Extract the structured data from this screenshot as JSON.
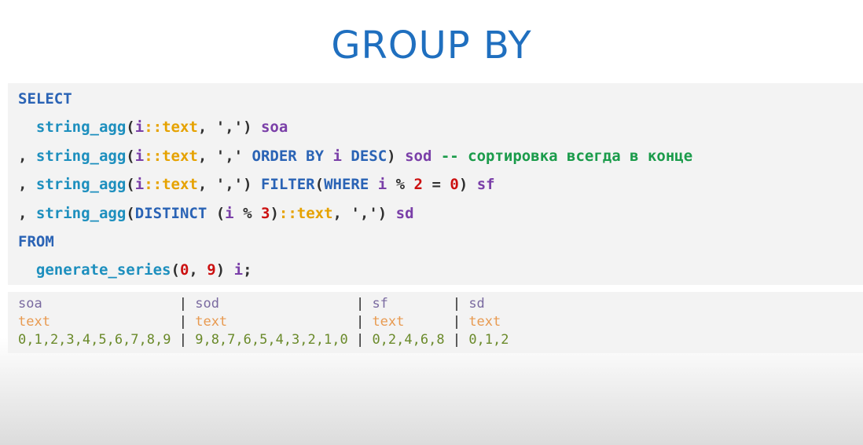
{
  "slide": {
    "title": "GROUP BY"
  },
  "code": {
    "select_kw": "SELECT",
    "l2_fn": "string_agg",
    "l2_open": "(",
    "l2_var": "i",
    "l2_cast": "::text",
    "l2_comma": ",",
    "l2_str": "','",
    "l2_close": ")",
    "l2_alias": "soa",
    "l3_lead": ",",
    "l3_fn": "string_agg",
    "l3_open": "(",
    "l3_var": "i",
    "l3_cast": "::text",
    "l3_comma": ",",
    "l3_str": "','",
    "l3_kw": "ORDER BY",
    "l3_var2": "i",
    "l3_kw2": "DESC",
    "l3_close": ")",
    "l3_alias": "sod",
    "l3_comment": "-- сортировка всегда в конце",
    "l4_lead": ",",
    "l4_fn": "string_agg",
    "l4_open": "(",
    "l4_var": "i",
    "l4_cast": "::text",
    "l4_comma": ",",
    "l4_str": "','",
    "l4_close": ")",
    "l4_kw": "FILTER",
    "l4_open2": "(",
    "l4_kw2": "WHERE",
    "l4_var2": "i",
    "l4_op": "%",
    "l4_num": "2",
    "l4_eq": "=",
    "l4_num2": "0",
    "l4_close2": ")",
    "l4_alias": "sf",
    "l5_lead": ",",
    "l5_fn": "string_agg",
    "l5_open": "(",
    "l5_kw": "DISTINCT",
    "l5_open2": "(",
    "l5_var": "i",
    "l5_op": "%",
    "l5_num": "3",
    "l5_close2": ")",
    "l5_cast": "::text",
    "l5_comma": ",",
    "l5_str": "','",
    "l5_close": ")",
    "l5_alias": "sd",
    "from_kw": "FROM",
    "l7_fn": "generate_series",
    "l7_open": "(",
    "l7_num": "0",
    "l7_comma": ",",
    "l7_num2": "9",
    "l7_close": ")",
    "l7_var": "i",
    "l7_semi": ";"
  },
  "result": {
    "headers": [
      "soa",
      "sod",
      "sf",
      "sd"
    ],
    "types": [
      "text",
      "text",
      "text",
      "text"
    ],
    "values": [
      "0,1,2,3,4,5,6,7,8,9",
      "9,8,7,6,5,4,3,2,1,0",
      "0,2,4,6,8",
      "0,1,2"
    ],
    "separator": "|"
  }
}
